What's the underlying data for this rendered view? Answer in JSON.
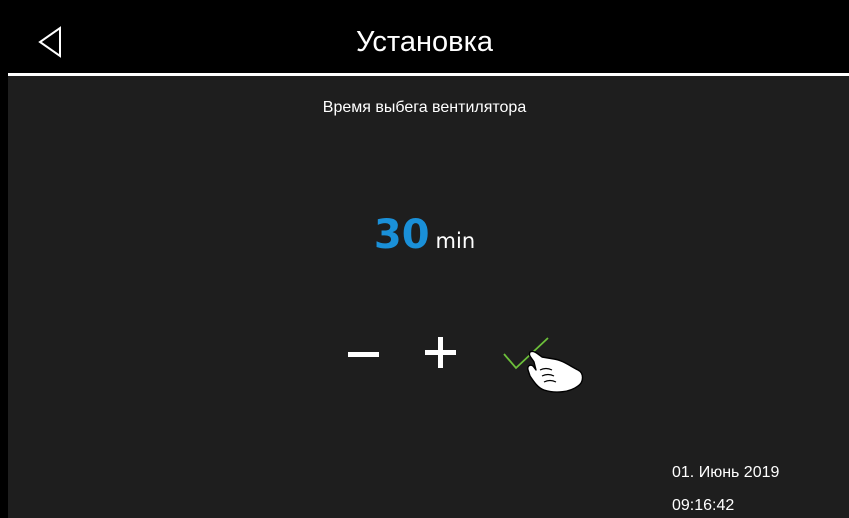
{
  "header": {
    "title": "Установка",
    "back_icon": "back-triangle-icon"
  },
  "setting": {
    "label": "Время выбега вентилятора",
    "value": "30",
    "unit": "min"
  },
  "controls": {
    "decrease_icon": "minus-icon",
    "increase_icon": "plus-icon",
    "confirm_icon": "checkmark-icon"
  },
  "status": {
    "date": "01. Июнь 2019",
    "time": "09:16:42"
  },
  "colors": {
    "background": "#000000",
    "panel": "#1e1e1e",
    "value_accent": "#1a90d8",
    "confirm_accent": "#6cbf3a",
    "text": "#ffffff"
  }
}
